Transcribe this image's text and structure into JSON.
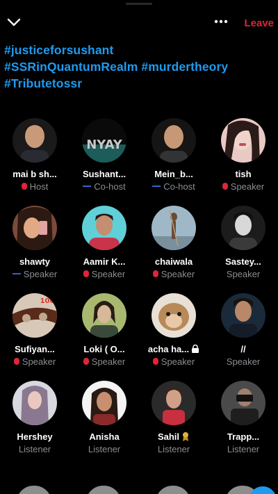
{
  "topbar": {
    "leave_label": "Leave",
    "collapse_icon": "chevron-down-icon",
    "more_icon": "more-icon"
  },
  "hashtags": [
    "#justiceforsushant",
    "#SSRinQuantumRealm",
    "#murdertheory",
    "#Tributetossr"
  ],
  "participants": [
    {
      "name": "mai b sh...",
      "role": "Host",
      "status": "muted"
    },
    {
      "name": "Sushant...",
      "role": "Co-host",
      "status": "speaking"
    },
    {
      "name": "Mein_b...",
      "role": "Co-host",
      "status": "speaking"
    },
    {
      "name": "tish",
      "role": "Speaker",
      "status": "muted"
    },
    {
      "name": "shawty",
      "role": "Speaker",
      "status": "speaking"
    },
    {
      "name": "Aamir K...",
      "role": "Speaker",
      "status": "muted"
    },
    {
      "name": "chaiwala",
      "role": "Speaker",
      "status": "muted"
    },
    {
      "name": "Sastey...",
      "role": "Speaker",
      "status": "none"
    },
    {
      "name": "Sufiyan...",
      "role": "Speaker",
      "status": "muted"
    },
    {
      "name": "Loki ( O...",
      "role": "Speaker",
      "status": "muted"
    },
    {
      "name": "acha ha...",
      "role": "Speaker",
      "status": "muted"
    },
    {
      "name": "//",
      "role": "Speaker",
      "status": "none"
    },
    {
      "name": "Hershey",
      "role": "Listener",
      "status": "none"
    },
    {
      "name": "Anisha",
      "role": "Listener",
      "status": "none"
    },
    {
      "name": "Sahil",
      "role": "Listener",
      "status": "none"
    },
    {
      "name": "Trapp...",
      "role": "Listener",
      "status": "none"
    }
  ],
  "colors": {
    "accent": "#1d9bf0",
    "leave": "#e0243a",
    "muted_mic": "#e0243a",
    "speaking_wave": "#3a63c9",
    "secondary_text": "#8a8d91"
  }
}
